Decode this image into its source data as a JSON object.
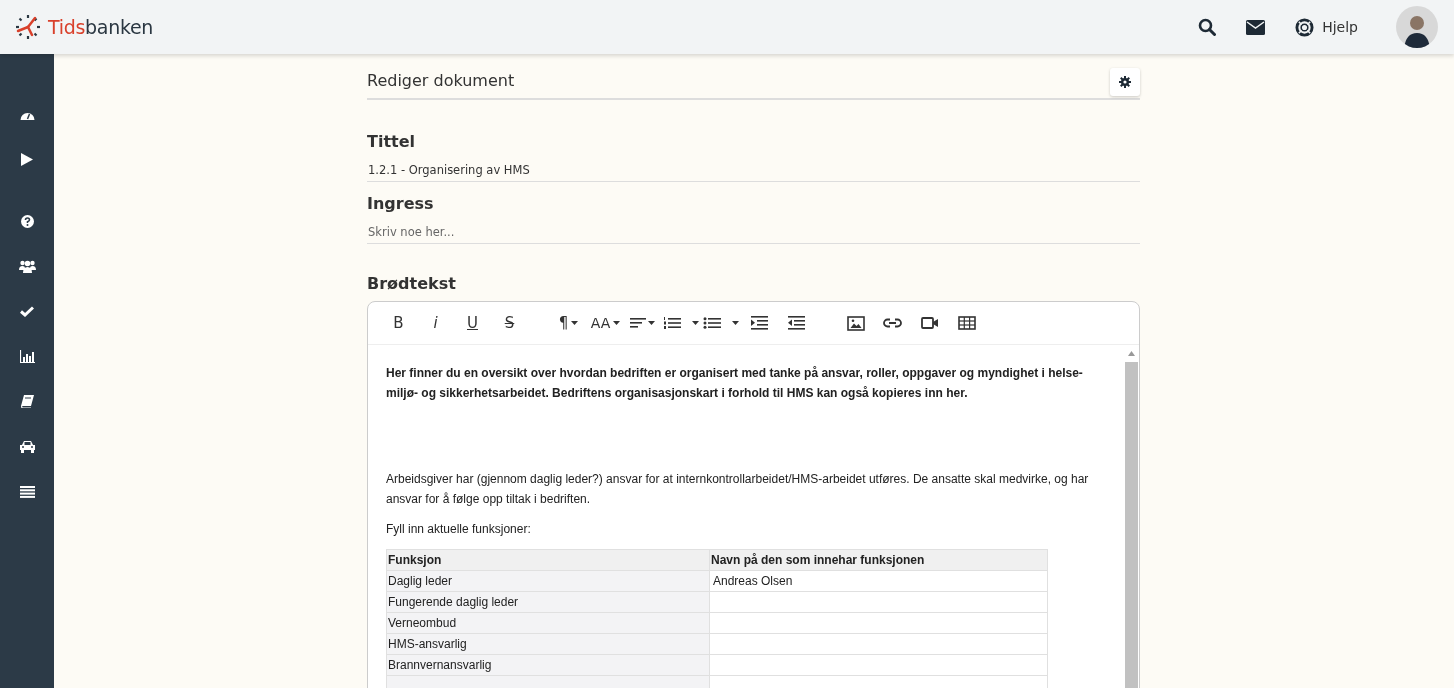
{
  "logo": {
    "accent": "Tids",
    "rest": "banken"
  },
  "header": {
    "help_label": "Hjelp"
  },
  "page_title": "Rediger dokument",
  "fields": [
    {
      "label": "Tittel",
      "value": "1.2.1 - Organisering av HMS"
    },
    {
      "label": "Ingress",
      "placeholder": "Skriv noe her..."
    }
  ],
  "body_label": "Brødtekst",
  "toolbar": {
    "format_glyphs": [
      {
        "glyph": "B"
      },
      {
        "glyph": "i"
      },
      {
        "glyph": "U"
      },
      {
        "glyph": "S"
      }
    ],
    "paragraph_glyph": "¶",
    "size_glyph": "AA"
  },
  "editor": {
    "intro": "Her finner du en oversikt over hvordan bedriften er organisert med tanke på ansvar, roller, oppgaver og myndighet i helse- miljø- og sikkerhetsarbeidet. Bedriftens organisasjonskart i forhold til HMS kan også kopieres inn her.",
    "paragraphs": [
      "Arbeidsgiver har (gjennom daglig leder?) ansvar for at internkontrollarbeidet/HMS-arbeidet utføres. De ansatte skal medvirke, og har ansvar for å følge opp tiltak i bedriften.",
      "Fyll inn aktuelle funksjoner:"
    ],
    "table": {
      "columns": [
        "Funksjon",
        "Navn på den som innehar funksjonen"
      ],
      "rows": [
        [
          "Daglig leder",
          "Andreas Olsen"
        ],
        [
          "Fungerende daglig leder",
          ""
        ],
        [
          "Verneombud",
          ""
        ],
        [
          "HMS-ansvarlig",
          ""
        ],
        [
          "Brannvernansvarlig",
          ""
        ]
      ]
    }
  }
}
